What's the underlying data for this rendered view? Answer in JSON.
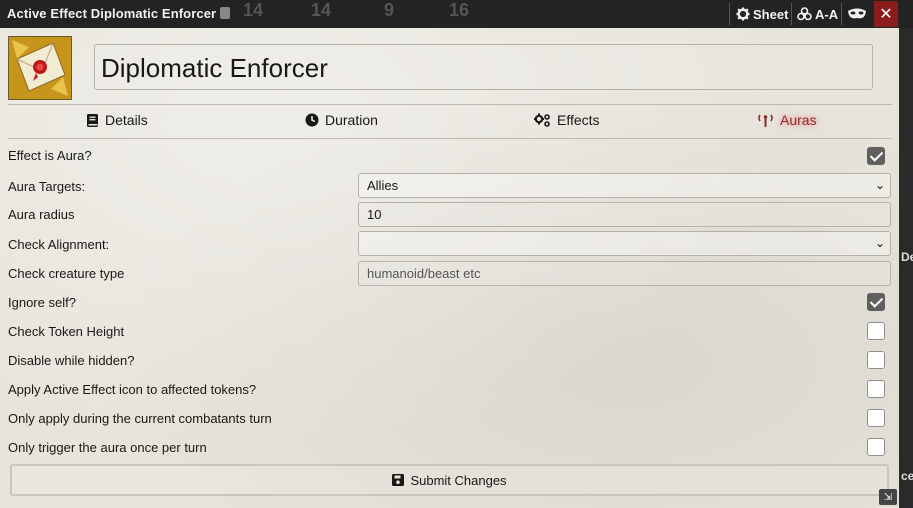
{
  "window": {
    "title": "Active Effect Diplomatic Enforcer",
    "header_buttons": {
      "sheet": "Sheet",
      "accessibility": "A-A"
    },
    "background_numbers": [
      "14",
      "14",
      "9",
      "16"
    ],
    "background_fragments": [
      "De",
      "ces"
    ]
  },
  "effect": {
    "name": "Diplomatic Enforcer"
  },
  "tabs": [
    {
      "label": "Details",
      "icon": "book-icon"
    },
    {
      "label": "Duration",
      "icon": "clock-icon"
    },
    {
      "label": "Effects",
      "icon": "gears-icon"
    },
    {
      "label": "Auras",
      "icon": "broadcast-tower-icon",
      "active": true
    }
  ],
  "form": {
    "effect_is_aura": {
      "label": "Effect is Aura?",
      "checked": true
    },
    "aura_targets": {
      "label": "Aura Targets:",
      "value": "Allies"
    },
    "aura_radius": {
      "label": "Aura radius",
      "value": "10"
    },
    "check_alignment": {
      "label": "Check Alignment:",
      "value": ""
    },
    "check_creature_type": {
      "label": "Check creature type",
      "placeholder": "humanoid/beast etc"
    },
    "ignore_self": {
      "label": "Ignore self?",
      "checked": true
    },
    "check_token_height": {
      "label": "Check Token Height",
      "checked": false
    },
    "disable_while_hidden": {
      "label": "Disable while hidden?",
      "checked": false
    },
    "apply_icon": {
      "label": "Apply Active Effect icon to affected tokens?",
      "checked": false
    },
    "current_turn_only": {
      "label": "Only apply during the current combatants turn",
      "checked": false
    },
    "once_per_turn": {
      "label": "Only trigger the aura once per turn",
      "checked": false
    }
  },
  "submit_label": "Submit Changes",
  "colors": {
    "accent_active_tab": "#8b2d2d",
    "close_button": "#8b1c1c",
    "parchment": "#e7e4dc"
  }
}
